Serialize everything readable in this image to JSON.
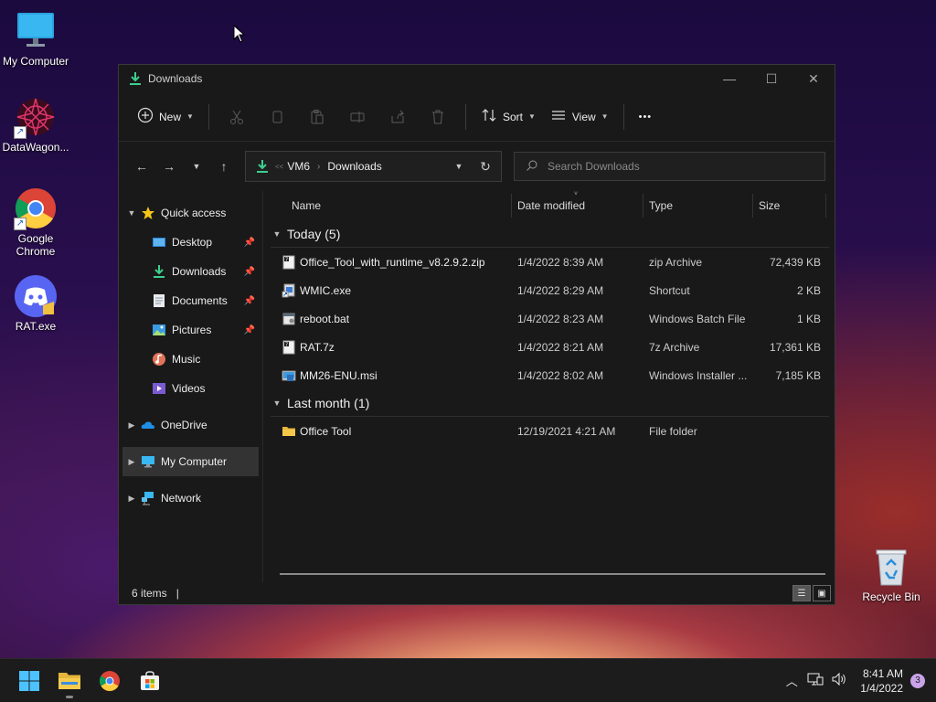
{
  "desktop": {
    "icons": [
      {
        "label": "My Computer",
        "icon": "monitor-icon"
      },
      {
        "label": "DataWagon...",
        "icon": "datawagon-icon"
      },
      {
        "label": "Google Chrome",
        "icon": "chrome-icon"
      },
      {
        "label": "RAT.exe",
        "icon": "discord-icon"
      },
      {
        "label": "Recycle Bin",
        "icon": "recycle-bin-icon"
      }
    ]
  },
  "window": {
    "title": "Downloads",
    "controls": {
      "minimize": "—",
      "maximize": "☐",
      "close": "✕"
    }
  },
  "commandbar": {
    "new_label": "New",
    "sort_label": "Sort",
    "view_label": "View",
    "more_label": "•••"
  },
  "address": {
    "prefix": "<<",
    "crumbs": [
      "VM6",
      "Downloads"
    ],
    "separator": "›"
  },
  "search": {
    "placeholder": "Search Downloads"
  },
  "navpane": {
    "quick_access": "Quick access",
    "items": [
      {
        "label": "Desktop",
        "icon": "desktop-icon",
        "pinned": true
      },
      {
        "label": "Downloads",
        "icon": "download-icon",
        "pinned": true
      },
      {
        "label": "Documents",
        "icon": "documents-icon",
        "pinned": true
      },
      {
        "label": "Pictures",
        "icon": "pictures-icon",
        "pinned": true
      },
      {
        "label": "Music",
        "icon": "music-icon",
        "pinned": false
      },
      {
        "label": "Videos",
        "icon": "videos-icon",
        "pinned": false
      }
    ],
    "onedrive": "OneDrive",
    "my_computer": "My Computer",
    "network": "Network"
  },
  "columns": {
    "name": "Name",
    "date": "Date modified",
    "type": "Type",
    "size": "Size"
  },
  "groups": [
    {
      "label": "Today (5)",
      "files": [
        {
          "name": "Office_Tool_with_runtime_v8.2.9.2.zip",
          "date": "1/4/2022 8:39 AM",
          "type": "zip Archive",
          "size": "72,439 KB"
        },
        {
          "name": "WMIC.exe",
          "date": "1/4/2022 8:29 AM",
          "type": "Shortcut",
          "size": "2 KB"
        },
        {
          "name": "reboot.bat",
          "date": "1/4/2022 8:23 AM",
          "type": "Windows Batch File",
          "size": "1 KB"
        },
        {
          "name": "RAT.7z",
          "date": "1/4/2022 8:21 AM",
          "type": "7z Archive",
          "size": "17,361 KB"
        },
        {
          "name": "MM26-ENU.msi",
          "date": "1/4/2022 8:02 AM",
          "type": "Windows Installer ...",
          "size": "7,185 KB"
        }
      ]
    },
    {
      "label": "Last month (1)",
      "files": [
        {
          "name": "Office Tool",
          "date": "12/19/2021 4:21 AM",
          "type": "File folder",
          "size": ""
        }
      ]
    }
  ],
  "status": {
    "count": "6 items",
    "caret": "|"
  },
  "taskbar": {
    "time": "8:41 AM",
    "date": "1/4/2022",
    "notifications": "3"
  }
}
